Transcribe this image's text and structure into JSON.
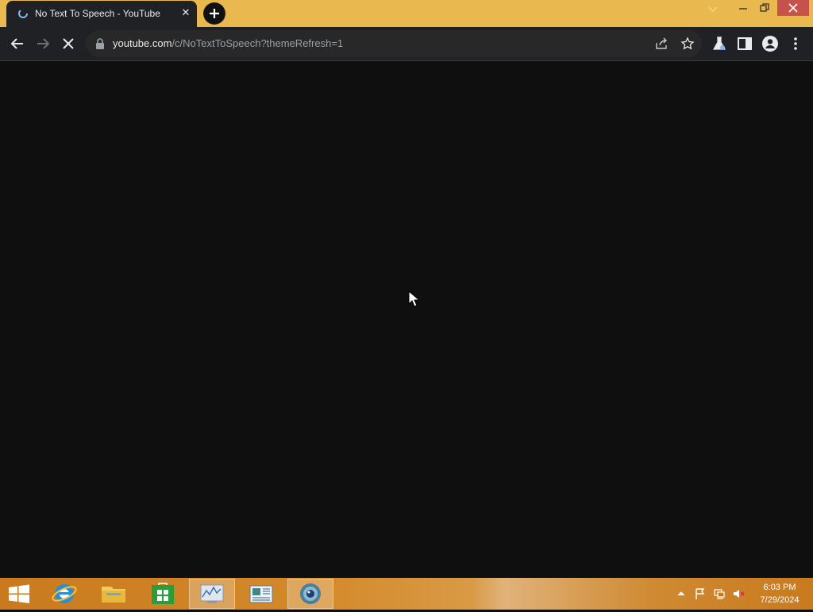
{
  "browser": {
    "tab": {
      "title": "No Text To Speech - YouTube",
      "close": "✕"
    },
    "address": {
      "host": "youtube.com",
      "path": "/c/NoTextToSpeech?themeRefresh=1"
    }
  },
  "colors": {
    "titlebar": "#e9b84e",
    "toolbar": "#202124",
    "content_bg": "#0f0f0f",
    "close_button": "#c7524b"
  },
  "taskbar": {
    "items": [
      {
        "icon": "internet-explorer-icon"
      },
      {
        "icon": "file-explorer-icon"
      },
      {
        "icon": "store-icon"
      },
      {
        "icon": "performance-monitor-icon"
      },
      {
        "icon": "news-icon"
      },
      {
        "icon": "chrome-icon"
      }
    ],
    "clock": {
      "time": "6:03 PM",
      "date": "7/29/2024"
    }
  }
}
